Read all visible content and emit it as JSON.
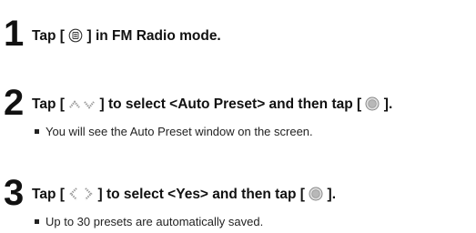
{
  "steps": [
    {
      "number": "1",
      "parts": [
        "Tap [",
        "] in FM Radio mode."
      ],
      "icons": [
        "menu-icon"
      ]
    },
    {
      "number": "2",
      "parts": [
        "Tap [",
        "] to select <Auto Preset> and then tap [",
        "]."
      ],
      "icons": [
        "up-down-arrows-icon",
        "select-button-icon"
      ],
      "note": "You will see the Auto Preset window on the screen."
    },
    {
      "number": "3",
      "parts": [
        "Tap [",
        "] to select <Yes> and then tap [",
        "]."
      ],
      "icons": [
        "left-right-arrows-icon",
        "select-button-icon"
      ],
      "note": "Up to 30 presets are automatically saved."
    }
  ]
}
